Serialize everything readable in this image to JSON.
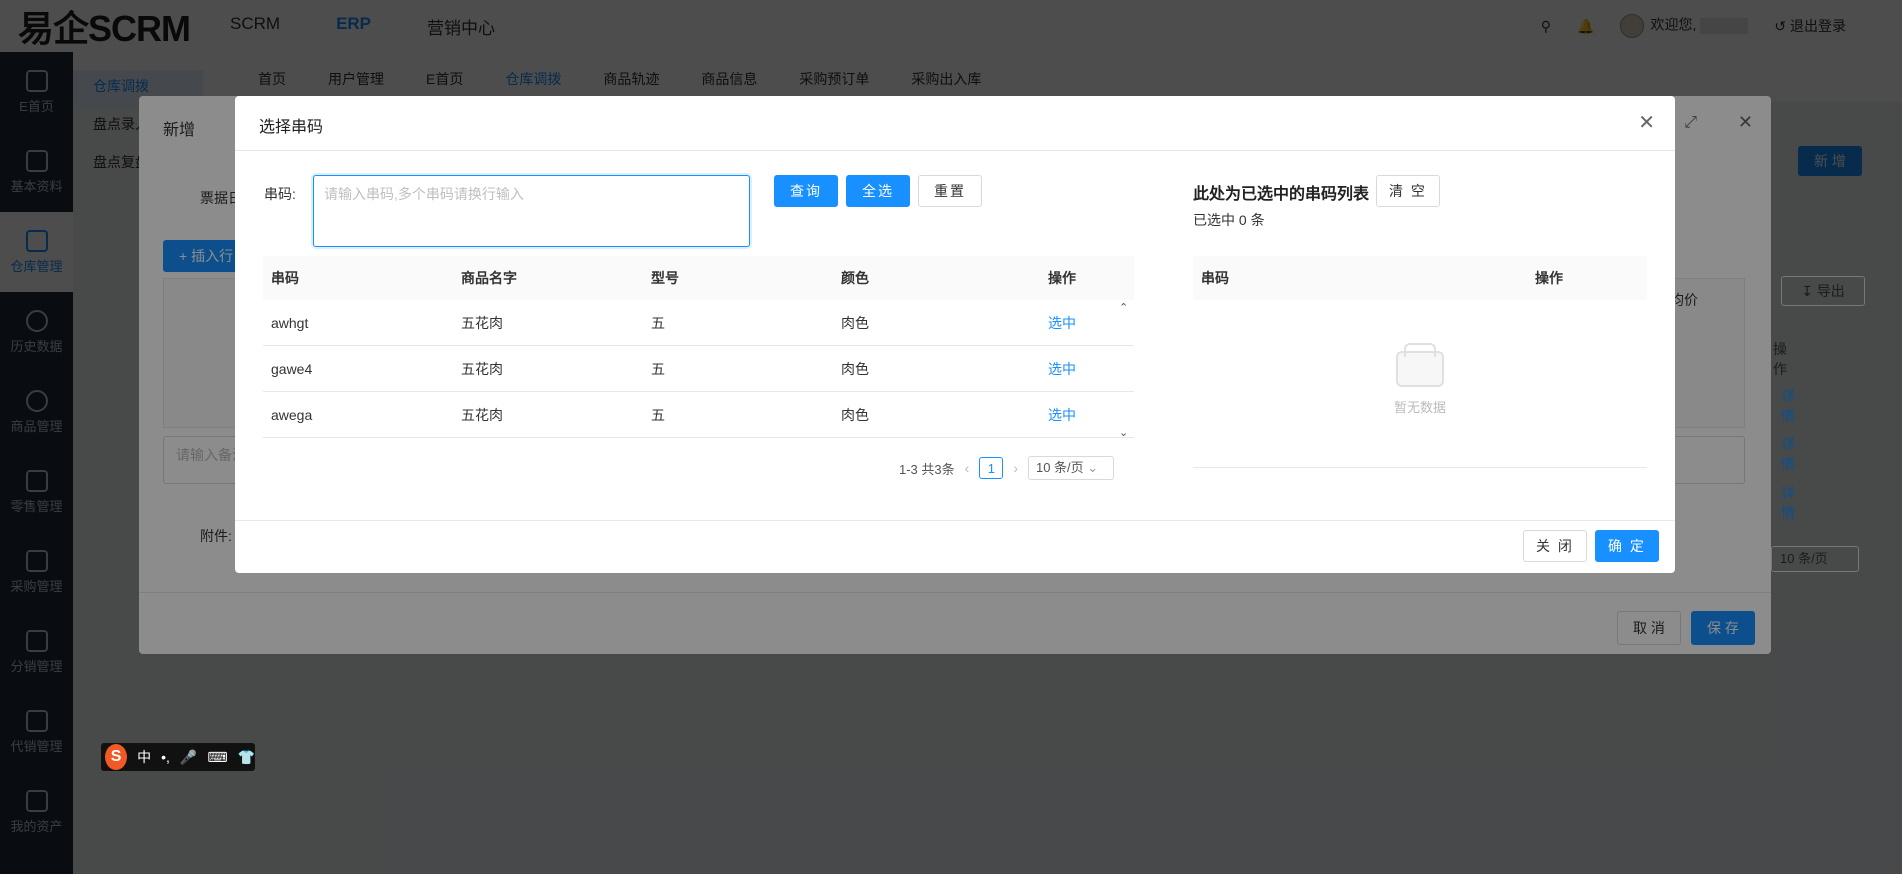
{
  "app": {
    "logo": "易企SCRM",
    "top_nav": [
      "SCRM",
      "ERP",
      "营销中心"
    ],
    "user": {
      "welcome": "欢迎您,",
      "logout": "退出登录"
    }
  },
  "sidebar": {
    "items": [
      {
        "label": "E首页",
        "icon": "home-icon"
      },
      {
        "label": "基本资料",
        "icon": "bag-icon"
      },
      {
        "label": "仓库管理",
        "icon": "chart-icon"
      },
      {
        "label": "历史数据",
        "icon": "clock-icon"
      },
      {
        "label": "商品管理",
        "icon": "yen-icon"
      },
      {
        "label": "零售管理",
        "icon": "store-icon"
      },
      {
        "label": "采购管理",
        "icon": "cart-icon"
      },
      {
        "label": "分销管理",
        "icon": "yen-box-icon"
      },
      {
        "label": "代销管理",
        "icon": "calendar-icon"
      },
      {
        "label": "我的资产",
        "icon": "wallet-icon"
      }
    ]
  },
  "subnav": {
    "tabs": [
      "首页",
      "用户管理",
      "E首页",
      "仓库调拨",
      "商品轨迹",
      "商品信息",
      "采购预订单",
      "采购出入库"
    ]
  },
  "left_menu": [
    "仓库调拨",
    "盘点录入",
    "盘点复盘"
  ],
  "bg_page": {
    "new_button": "新 增"
  },
  "add_modal": {
    "title": "新增",
    "label_ticket": "票据日",
    "insert_button": "插入行",
    "remark_placeholder": "请输入备注",
    "attachment_label": "附件:",
    "export_button": "导出",
    "price_col": "均价",
    "ops_header": "操作",
    "detail_link": "详情",
    "page_size": "10 条/页",
    "cancel_button": "取 消",
    "save_button": "保 存"
  },
  "serial_modal": {
    "title": "选择串码",
    "serial_label": "串码:",
    "serial_placeholder": "请输入串码,多个串码请换行输入",
    "query_button": "查询",
    "select_all_button": "全选",
    "reset_button": "重置",
    "table": {
      "headers": [
        "串码",
        "商品名字",
        "型号",
        "颜色",
        "操作"
      ],
      "rows": [
        {
          "serial": "awhgt",
          "name": "五花肉",
          "model": "五",
          "color": "肉色",
          "action": "选中"
        },
        {
          "serial": "gawe4",
          "name": "五花肉",
          "model": "五",
          "color": "肉色",
          "action": "选中"
        },
        {
          "serial": "awega",
          "name": "五花肉",
          "model": "五",
          "color": "肉色",
          "action": "选中"
        }
      ]
    },
    "pagination": {
      "summary": "1-3 共3条",
      "current_page": "1",
      "page_size": "10 条/页"
    },
    "selected": {
      "title": "此处为已选中的串码列表",
      "clear_button": "清 空",
      "count_text": "已选中 0 条",
      "headers": [
        "串码",
        "操作"
      ],
      "empty_text": "暂无数据"
    },
    "close_button": "关 闭",
    "confirm_button": "确 定"
  },
  "ime": {
    "mode": "中"
  },
  "colors": {
    "primary": "#1890ff",
    "sidebar_bg": "#1f2d3d"
  }
}
